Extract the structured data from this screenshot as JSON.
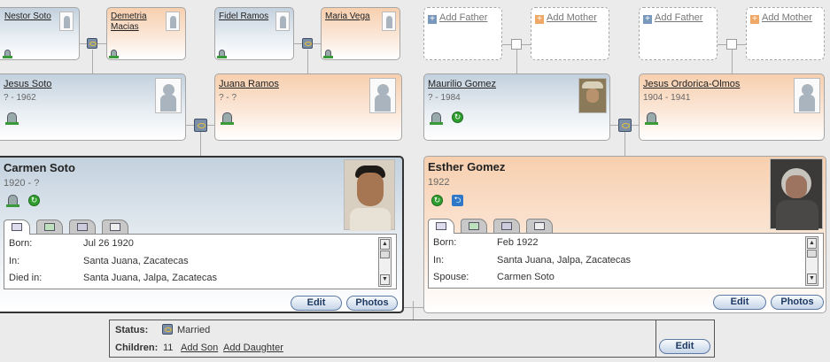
{
  "grandparents": {
    "nestor": "Nestor Soto",
    "demetria": "Demetria Macias",
    "fidel": "Fidel Ramos",
    "maria": "Maria Vega"
  },
  "add_father": "Add Father",
  "add_mother": "Add Mother",
  "parents": {
    "jesus_soto": {
      "name": "Jesus Soto",
      "dates": "? - 1962"
    },
    "juana": {
      "name": "Juana Ramos",
      "dates": "? - ?"
    },
    "maurilio": {
      "name": "Maurilio Gomez",
      "dates": "? - 1984"
    },
    "jesus_ordorica": {
      "name": "Jesus Ordorica-Olmos",
      "dates": "1904 - 1941"
    }
  },
  "focus_left": {
    "name": "Carmen Soto",
    "dates": "1920 - ?",
    "rows": [
      {
        "label": "Born:",
        "value": "Jul 26 1920"
      },
      {
        "label": "In:",
        "value": "Santa Juana, Zacatecas"
      },
      {
        "label": "Died in:",
        "value": "Santa Juana, Jalpa, Zacatecas"
      }
    ]
  },
  "focus_right": {
    "name": "Esther Gomez",
    "dates": "1922",
    "rows": [
      {
        "label": "Born:",
        "value": "Feb 1922"
      },
      {
        "label": "In:",
        "value": "Santa Juana, Jalpa, Zacatecas"
      },
      {
        "label": "Spouse:",
        "value": "Carmen Soto"
      }
    ]
  },
  "buttons": {
    "edit": "Edit",
    "photos": "Photos"
  },
  "status": {
    "status_label": "Status:",
    "status_value": "Married",
    "children_label": "Children:",
    "children_count": "11",
    "add_son": "Add Son",
    "add_daughter": "Add Daughter"
  }
}
